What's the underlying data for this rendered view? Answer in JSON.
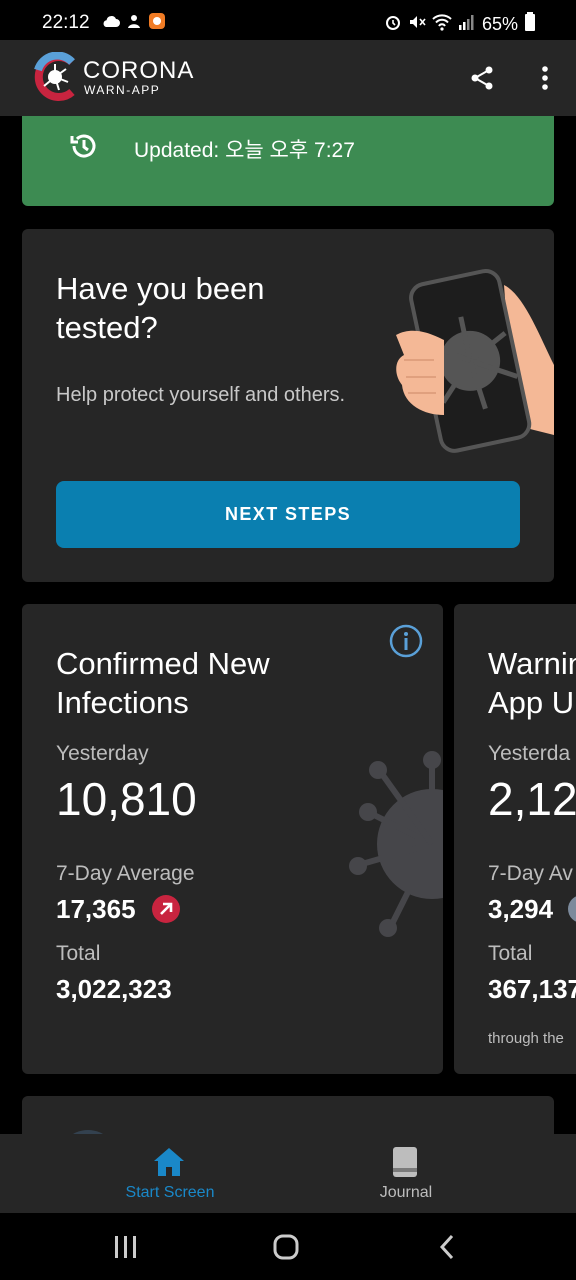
{
  "status_bar": {
    "time": "22:12",
    "battery": "65%",
    "icons": [
      "cloud-icon",
      "notification-icon",
      "app-icon",
      "alarm-icon",
      "mute-icon",
      "wifi-icon",
      "signal-icon",
      "battery-icon"
    ]
  },
  "app_bar": {
    "brand_top": "CORONA",
    "brand_bottom": "WARN-APP",
    "share_icon": "share-icon",
    "menu_icon": "more-vert-icon"
  },
  "updated": {
    "text": "Updated: 오늘 오후 7:27",
    "icon": "history-clock-icon",
    "color": "#3d8b52"
  },
  "test_card": {
    "title": "Have you been tested?",
    "body": "Help protect yourself and others.",
    "button": "NEXT STEPS",
    "button_color": "#0a7fb0"
  },
  "stats": [
    {
      "title_line1": "Confirmed New",
      "title_line2": "Infections",
      "yesterday_label": "Yesterday",
      "yesterday_value": "10,810",
      "avg_label": "7-Day Average",
      "avg_value": "17,365",
      "trend": "up",
      "total_label": "Total",
      "total_value": "3,022,323"
    },
    {
      "title_line1": "Warnin",
      "title_line2": "App U",
      "yesterday_label": "Yesterda",
      "yesterday_value": "2,12",
      "avg_label": "7-Day Av",
      "avg_value": "3,294",
      "total_label": "Total",
      "total_value": "367,137",
      "footnote": "through the"
    }
  ],
  "bottom_nav": [
    {
      "label": "Start Screen",
      "icon": "home-icon",
      "active": true
    },
    {
      "label": "Journal",
      "icon": "book-icon",
      "active": false
    }
  ],
  "system_nav": [
    "recents-icon",
    "home-circle-icon",
    "back-icon"
  ]
}
